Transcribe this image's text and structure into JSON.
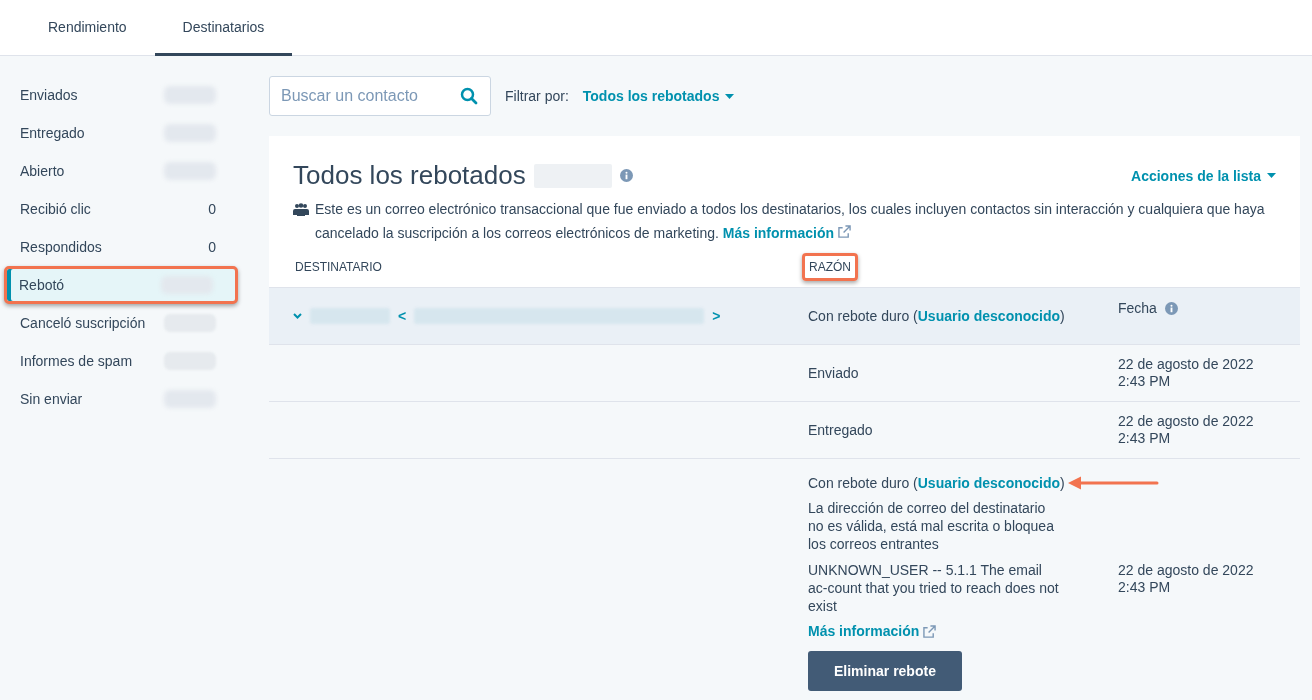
{
  "tabs": [
    {
      "label": "Rendimiento",
      "selected": false
    },
    {
      "label": "Destinatarios",
      "selected": true
    }
  ],
  "sidebar": {
    "items": [
      {
        "label": "Enviados",
        "count_redacted": true,
        "selected": false,
        "highlighted": false
      },
      {
        "label": "Entregado",
        "count_redacted": true,
        "selected": false,
        "highlighted": false
      },
      {
        "label": "Abierto",
        "count_redacted": true,
        "selected": false,
        "highlighted": false
      },
      {
        "label": "Recibió clic",
        "count": "0",
        "selected": false,
        "highlighted": false
      },
      {
        "label": "Respondidos",
        "count": "0",
        "selected": false,
        "highlighted": false
      },
      {
        "label": "Rebotó",
        "count_redacted": true,
        "selected": true,
        "highlighted": true
      },
      {
        "label": "Canceló suscripción",
        "count_redacted": true,
        "selected": false,
        "highlighted": false
      },
      {
        "label": "Informes de spam",
        "count_redacted": true,
        "selected": false,
        "highlighted": false
      },
      {
        "label": "Sin enviar",
        "count_redacted": true,
        "selected": false,
        "highlighted": false
      }
    ]
  },
  "search": {
    "placeholder": "Buscar un contacto"
  },
  "filter": {
    "label": "Filtrar por:",
    "value": "Todos los rebotados"
  },
  "list": {
    "title": "Todos los rebotados",
    "title_redacted": true,
    "actions": "Acciones de la lista",
    "notice": {
      "text": "Este es un correo electrónico transaccional que fue enviado a todos los destinatarios, los cuales incluyen contactos sin interacción y cualquiera que haya cancelado la suscripción a los correos electrónicos de marketing.",
      "link": "Más información"
    },
    "columns": [
      {
        "label": "DESTINATARIO",
        "highlighted": false
      },
      {
        "label": "RAZÓN",
        "highlighted": true
      }
    ],
    "recipient": {
      "expanded": true,
      "name_redacted": true,
      "email_open": "<",
      "email_close": ">",
      "reason": {
        "prefix": "Con rebote duro (",
        "link": "Usuario desconocido",
        "suffix": ")"
      },
      "date_header": "Fecha"
    },
    "events": [
      {
        "kind": "event",
        "status": "Enviado",
        "date": "22 de agosto de 2022",
        "time": "2:43 PM"
      },
      {
        "kind": "event",
        "status": "Entregado",
        "date": "22 de agosto de 2022",
        "time": "2:43 PM"
      },
      {
        "kind": "bounce",
        "reason": {
          "prefix": "Con rebote duro (",
          "link": "Usuario desconocido",
          "suffix": ")"
        },
        "arrow": true,
        "description": "La dirección de correo del destinatario no es válida, está mal escrita o bloquea los correos entrantes",
        "code": "UNKNOWN_USER -- 5.1.1 The email ac-count that you tried to reach does not exist",
        "link": "Más información",
        "button": "Eliminar rebote",
        "date": "22 de agosto de 2022",
        "time": "2:43 PM"
      }
    ]
  }
}
